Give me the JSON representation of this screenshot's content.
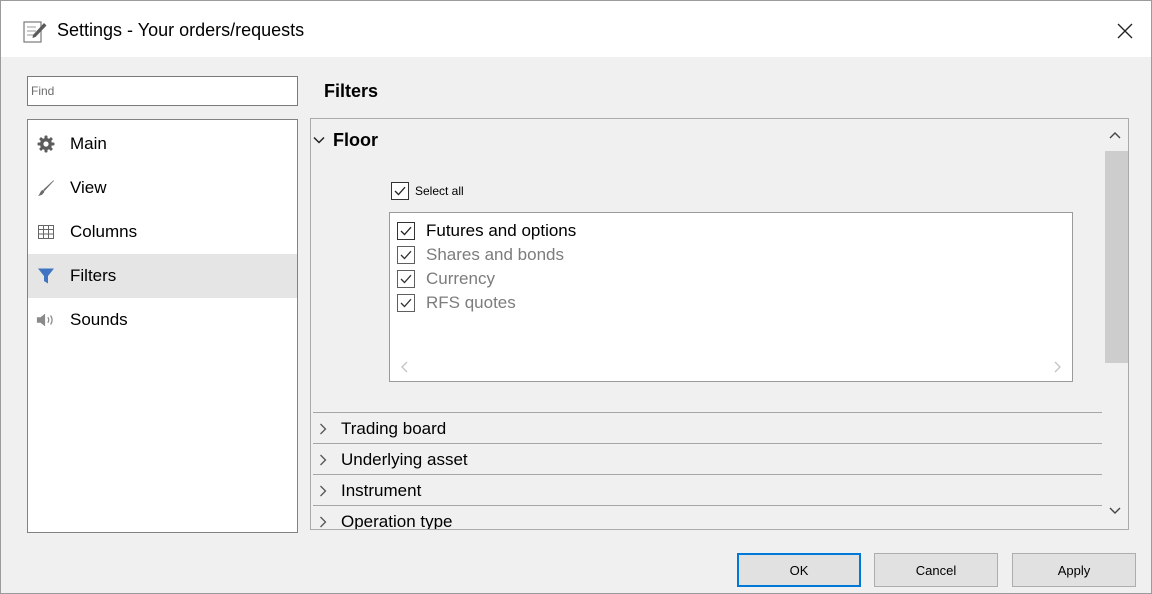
{
  "window": {
    "title": "Settings - Your orders/requests",
    "icon": "settings-doc-icon",
    "close_icon": "close-icon"
  },
  "search": {
    "placeholder": "Find",
    "value": ""
  },
  "nav": {
    "items": [
      {
        "label": "Main",
        "icon": "gear-icon",
        "active": false
      },
      {
        "label": "View",
        "icon": "brush-icon",
        "active": false
      },
      {
        "label": "Columns",
        "icon": "columns-icon",
        "active": false
      },
      {
        "label": "Filters",
        "icon": "funnel-icon",
        "active": true
      },
      {
        "label": "Sounds",
        "icon": "speaker-icon",
        "active": false
      }
    ]
  },
  "main": {
    "title": "Filters",
    "floor": {
      "label": "Floor",
      "expanded": true,
      "select_all": {
        "label": "Select all",
        "checked": true
      },
      "options": [
        {
          "label": "Futures and options",
          "checked": true,
          "enabled": true
        },
        {
          "label": "Shares and bonds",
          "checked": true,
          "enabled": false
        },
        {
          "label": "Currency",
          "checked": true,
          "enabled": false
        },
        {
          "label": "RFS quotes",
          "checked": true,
          "enabled": false
        }
      ]
    },
    "groups": [
      {
        "label": "Trading board",
        "expanded": false
      },
      {
        "label": "Underlying asset",
        "expanded": false
      },
      {
        "label": "Instrument",
        "expanded": false
      },
      {
        "label": "Operation type",
        "expanded": false
      }
    ]
  },
  "buttons": {
    "ok": "OK",
    "cancel": "Cancel",
    "apply": "Apply"
  },
  "colors": {
    "focus_border": "#0078d7",
    "active_nav_bg": "#e5e5e5",
    "window_bg": "#f0f0f0"
  }
}
